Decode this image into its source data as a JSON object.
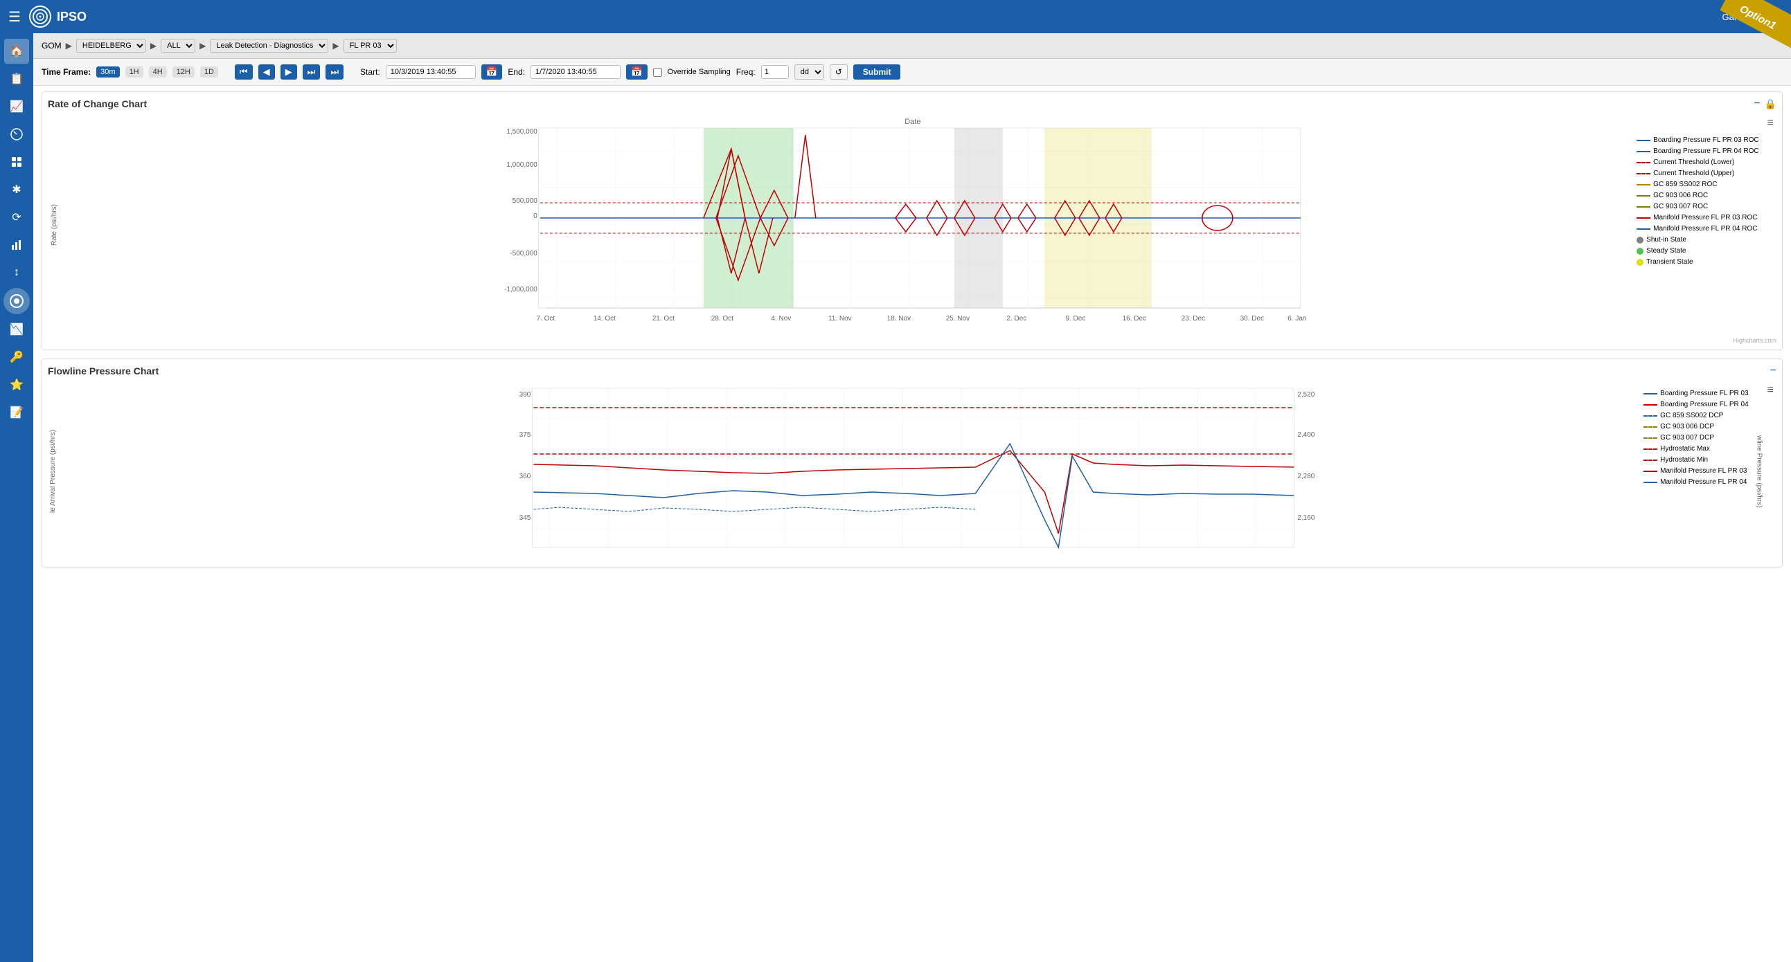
{
  "app": {
    "title": "IPSO",
    "user": "Ganesh Hegde",
    "option_badge": "Option1"
  },
  "breadcrumb": {
    "items": [
      "GOM",
      "HEIDELBERG",
      "ALL",
      "Leak Detection - Diagnostics",
      "FL PR 03"
    ]
  },
  "timeframe": {
    "label": "Time Frame:",
    "buttons": [
      "30m",
      "1H",
      "4H",
      "12H",
      "1D"
    ],
    "active_button": "30m",
    "start_label": "Start:",
    "start_value": "10/3/2019 13:40:55",
    "end_label": "End:",
    "end_value": "1/7/2020 13:40:55",
    "override_label": "Override Sampling",
    "freq_label": "Freq:",
    "freq_value": "1",
    "dd_value": "dd",
    "submit_label": "Submit"
  },
  "rate_of_change_chart": {
    "title": "Rate of Change Chart",
    "y_axis_label": "Rate (psi/hrs)",
    "x_axis_label": "Date",
    "x_ticks": [
      "7. Oct",
      "14. Oct",
      "21. Oct",
      "28. Oct",
      "4. Nov",
      "11. Nov",
      "18. Nov",
      "25. Nov",
      "2. Dec",
      "9. Dec",
      "16. Dec",
      "23. Dec",
      "30. Dec",
      "6. Jan"
    ],
    "y_ticks": [
      "-1,000,000",
      "-500,000",
      "0",
      "500,000",
      "1,000,000",
      "1,500,000"
    ],
    "legend": [
      {
        "label": "Boarding Pressure FL PR 03 ROC",
        "color": "#2060a0",
        "type": "solid"
      },
      {
        "label": "Boarding Pressure FL PR 04 ROC",
        "color": "#2060a0",
        "type": "solid"
      },
      {
        "label": "Current Threshold (Lower)",
        "color": "#c00000",
        "type": "dashed"
      },
      {
        "label": "Current Threshold (Upper)",
        "color": "#c00000",
        "type": "dashed"
      },
      {
        "label": "GC 859 SS002 ROC",
        "color": "#c08000",
        "type": "solid"
      },
      {
        "label": "GC 903 006 ROC",
        "color": "#808000",
        "type": "solid"
      },
      {
        "label": "GC 903 007 ROC",
        "color": "#808000",
        "type": "solid"
      },
      {
        "label": "Manifold Pressure FL PR 03 ROC",
        "color": "#c00000",
        "type": "solid"
      },
      {
        "label": "Manifold Pressure FL PR 04 ROC",
        "color": "#1060c0",
        "type": "solid"
      },
      {
        "label": "Shut-in State",
        "color": "#808080",
        "type": "circle"
      },
      {
        "label": "Steady State",
        "color": "#50c050",
        "type": "circle"
      },
      {
        "label": "Transient State",
        "color": "#e0e000",
        "type": "circle"
      }
    ],
    "regions": [
      {
        "type": "green",
        "x_start_pct": 28,
        "x_end_pct": 38
      },
      {
        "type": "gray",
        "x_start_pct": 54,
        "x_end_pct": 59
      },
      {
        "type": "yellow",
        "x_start_pct": 64,
        "x_end_pct": 76
      }
    ]
  },
  "flowline_pressure_chart": {
    "title": "Flowline Pressure Chart",
    "y_axis_left_label": "le Arrival Pressure (psi/hrs)",
    "y_axis_right_label": "wline Pressure (psi/hrs)",
    "y_left_ticks": [
      "345",
      "360",
      "375",
      "390"
    ],
    "y_right_ticks": [
      "2,160",
      "2,280",
      "2,400",
      "2,520"
    ],
    "legend": [
      {
        "label": "Boarding Pressure FL PR 03",
        "color": "#2060a0",
        "type": "solid"
      },
      {
        "label": "Boarding Pressure FL PR 04",
        "color": "#c00000",
        "type": "dashed"
      },
      {
        "label": "GC 859 SS002 DCP",
        "color": "#2060a0",
        "type": "dashed"
      },
      {
        "label": "GC 903 006 DCP",
        "color": "#808000",
        "type": "dashed"
      },
      {
        "label": "GC 903 007 DCP",
        "color": "#808000",
        "type": "dashed"
      },
      {
        "label": "Hydrostatic Max",
        "color": "#c00000",
        "type": "dashed"
      },
      {
        "label": "Hydrostatic Min",
        "color": "#c00000",
        "type": "dashed"
      },
      {
        "label": "Manifold Pressure FL PR 03",
        "color": "#c00000",
        "type": "solid"
      },
      {
        "label": "Manifold Pressure FL PR 04",
        "color": "#2060a0",
        "type": "solid"
      }
    ]
  },
  "sidebar": {
    "items": [
      {
        "icon": "🏠",
        "name": "home"
      },
      {
        "icon": "📋",
        "name": "clipboard"
      },
      {
        "icon": "📈",
        "name": "chart-line"
      },
      {
        "icon": "⚡",
        "name": "gauge"
      },
      {
        "icon": "🔧",
        "name": "tools"
      },
      {
        "icon": "✱",
        "name": "asterisk"
      },
      {
        "icon": "🔄",
        "name": "cycle"
      },
      {
        "icon": "📊",
        "name": "bar-chart"
      },
      {
        "icon": "↕",
        "name": "arrows"
      },
      {
        "icon": "🌊",
        "name": "wave"
      },
      {
        "icon": "👤",
        "name": "user-active"
      },
      {
        "icon": "📉",
        "name": "trend"
      },
      {
        "icon": "🔑",
        "name": "key"
      },
      {
        "icon": "⭐",
        "name": "star"
      },
      {
        "icon": "📝",
        "name": "list"
      }
    ]
  }
}
